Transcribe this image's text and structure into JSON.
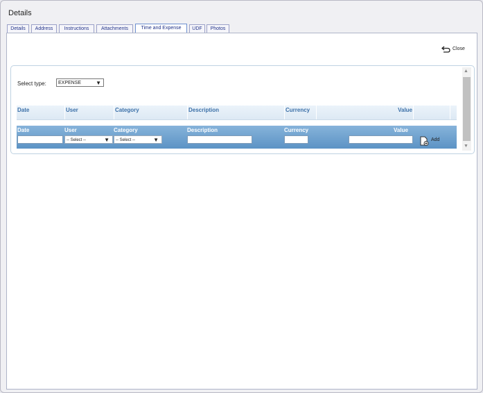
{
  "window": {
    "title": "Details"
  },
  "tabs": [
    {
      "label": "Details",
      "active": false
    },
    {
      "label": "Address",
      "active": false
    },
    {
      "label": "Instructions",
      "active": false
    },
    {
      "label": "Attachments",
      "active": false
    },
    {
      "label": "Time and Expense",
      "active": true
    },
    {
      "label": "UDF",
      "active": false
    },
    {
      "label": "Photos",
      "active": false
    }
  ],
  "toolbar": {
    "close_label": "Close"
  },
  "filter": {
    "select_type_label": "Select type:",
    "select_type_value": "EXPENSE"
  },
  "table": {
    "columns": [
      "Date",
      "User",
      "Category",
      "Description",
      "Currency",
      "Value"
    ],
    "rows": []
  },
  "form": {
    "labels": {
      "date": "Date",
      "user": "User",
      "category": "Category",
      "description": "Description",
      "currency": "Currency",
      "value": "Value"
    },
    "user_select": "-- Select --",
    "category_select": "-- Select --",
    "add_label": "Add"
  },
  "colors": {
    "header_text": "#3c70a8",
    "form_bar": "#6a9fcf",
    "tab_text": "#23348a"
  }
}
